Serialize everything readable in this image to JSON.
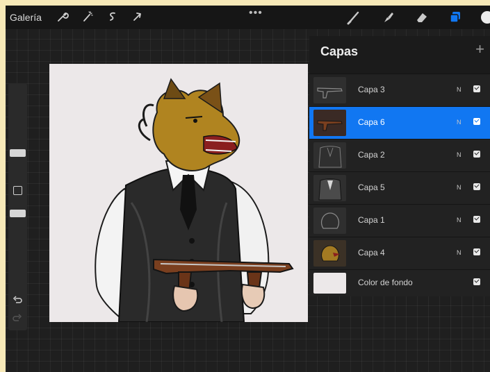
{
  "topbar": {
    "gallery_label": "Galería",
    "tools_left": [
      "wrench-icon",
      "magic-wand-icon",
      "selection-icon",
      "transform-arrow-icon"
    ],
    "more_label": "•••",
    "tools_right": [
      "brush-icon",
      "smudge-icon",
      "eraser-icon",
      "layers-icon",
      "color-icon"
    ]
  },
  "layers": {
    "title": "Capas",
    "add_label": "+",
    "items": [
      {
        "name": "Capa 3",
        "blend": "N",
        "visible": true,
        "selected": false,
        "thumb": "gun-sketch"
      },
      {
        "name": "Capa 6",
        "blend": "N",
        "visible": true,
        "selected": true,
        "thumb": "gun-color"
      },
      {
        "name": "Capa 2",
        "blend": "N",
        "visible": true,
        "selected": false,
        "thumb": "body-sketch"
      },
      {
        "name": "Capa 5",
        "blend": "N",
        "visible": true,
        "selected": false,
        "thumb": "body-shading"
      },
      {
        "name": "Capa 1",
        "blend": "N",
        "visible": true,
        "selected": false,
        "thumb": "head-sketch"
      },
      {
        "name": "Capa 4",
        "blend": "N",
        "visible": true,
        "selected": false,
        "thumb": "head-color"
      }
    ],
    "background": {
      "name": "Color de fondo",
      "visible": true
    }
  },
  "sidebar": {
    "undo_icon": "undo-icon",
    "redo_icon": "redo-icon"
  },
  "colors": {
    "accent": "#1177f2",
    "canvas_bg": "#ece8e9",
    "app_bg": "#1f1f1f"
  }
}
